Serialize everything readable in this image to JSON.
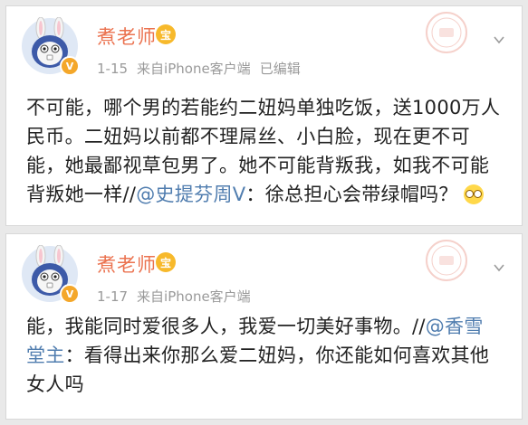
{
  "posts": [
    {
      "username": "煮老师",
      "crown_badge": "宝",
      "verified_badge": "V",
      "time": "1-15",
      "source": "来自iPhone客户端",
      "edited": "已编辑",
      "text_before_mention": "不可能，哪个男的若能约二妞妈单独吃饭，送1000万人民币。二妞妈以前都不理屌丝、小白脸，现在更不可能，她最鄙视草包男了。她不可能背叛我，如我不可能背叛她一样//",
      "mention": "@史提芬周V",
      "text_after_mention": "：徐总担心会带绿帽吗？",
      "emoji": "glasses-emoji"
    },
    {
      "username": "煮老师",
      "crown_badge": "宝",
      "verified_badge": "V",
      "time": "1-17",
      "source": "来自iPhone客户端",
      "text_before_mention": "能，我能同时爱很多人，我爱一切美好事物。//",
      "mention": "@香雪堂主",
      "text_after_mention": "：看得出来你那么爱二妞妈，你还能如何喜欢其他女人吗"
    }
  ],
  "colors": {
    "username": "#eb7350",
    "mention": "#507daf",
    "meta": "#9a9a9a",
    "text": "#222222"
  }
}
